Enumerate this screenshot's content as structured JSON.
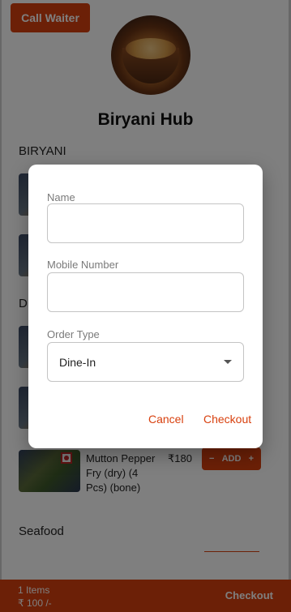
{
  "header": {
    "call_waiter_label": "Call Waiter"
  },
  "restaurant": {
    "name": "Biryani Hub"
  },
  "sections": {
    "biryani": "BIRYANI",
    "dry_partial": "D",
    "seafood": "Seafood"
  },
  "item": {
    "name": "Mutton Pepper Fry (dry) (4 Pcs) (bone)",
    "price": "₹180",
    "add_label": "ADD",
    "minus": "−",
    "plus": "+"
  },
  "cart": {
    "count": "1 Items",
    "total": "₹ 100 /-",
    "checkout_label": "Checkout"
  },
  "modal": {
    "name_label": "Name",
    "name_value": "",
    "mobile_label": "Mobile Number",
    "mobile_value": "",
    "order_type_label": "Order Type",
    "order_type_value": "Dine-In",
    "cancel_label": "Cancel",
    "checkout_label": "Checkout"
  },
  "colors": {
    "accent": "#d8400e",
    "overlay": "rgba(0,0,0,0.5)"
  }
}
